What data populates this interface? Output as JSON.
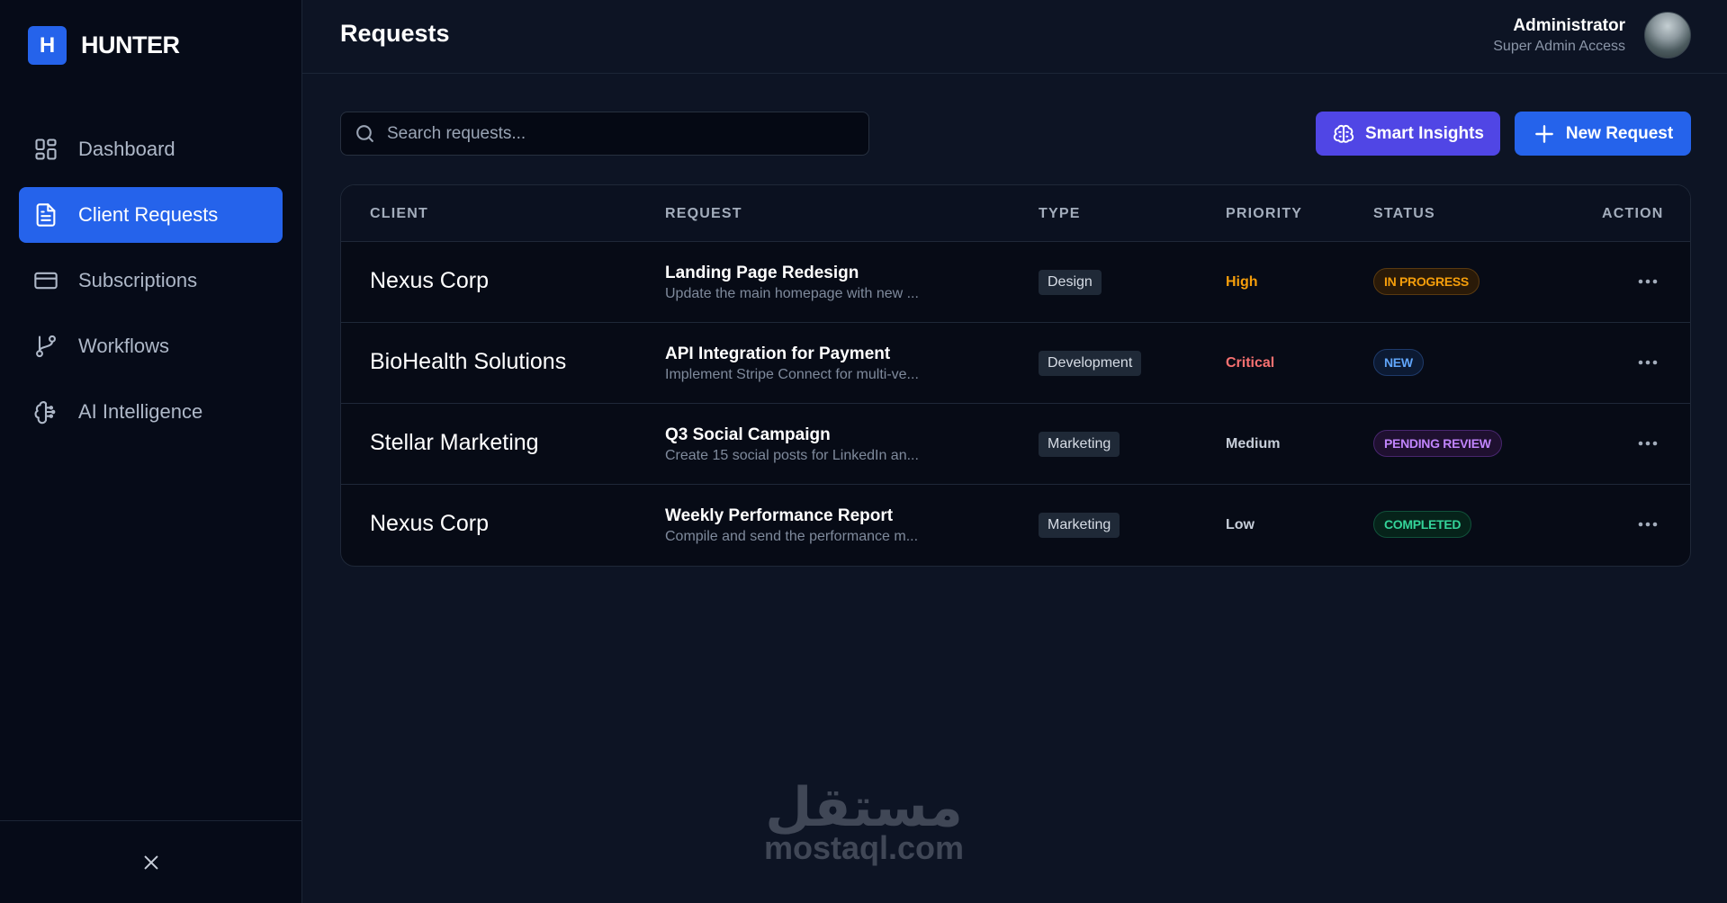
{
  "brand": {
    "badge": "H",
    "name": "HUNTER"
  },
  "sidebar": {
    "items": [
      {
        "label": "Dashboard",
        "icon": "dashboard-icon",
        "active": false
      },
      {
        "label": "Client Requests",
        "icon": "file-text-icon",
        "active": true
      },
      {
        "label": "Subscriptions",
        "icon": "credit-card-icon",
        "active": false
      },
      {
        "label": "Workflows",
        "icon": "git-branch-icon",
        "active": false
      },
      {
        "label": "AI Intelligence",
        "icon": "brain-icon",
        "active": false
      }
    ],
    "footer_icon": "close-icon"
  },
  "header": {
    "title": "Requests",
    "user": {
      "name": "Administrator",
      "role": "Super Admin Access"
    }
  },
  "toolbar": {
    "search_placeholder": "Search requests...",
    "insights_label": "Smart Insights",
    "new_label": "New Request"
  },
  "table": {
    "columns": [
      "CLIENT",
      "REQUEST",
      "TYPE",
      "PRIORITY",
      "STATUS",
      "ACTION"
    ],
    "rows": [
      {
        "client": "Nexus Corp",
        "title": "Landing Page Redesign",
        "desc": "Update the main homepage with new ...",
        "type": "Design",
        "priority": "High",
        "status": "IN PROGRESS"
      },
      {
        "client": "BioHealth Solutions",
        "title": "API Integration for Payment",
        "desc": "Implement Stripe Connect for multi-ve...",
        "type": "Development",
        "priority": "Critical",
        "status": "NEW"
      },
      {
        "client": "Stellar Marketing",
        "title": "Q3 Social Campaign",
        "desc": "Create 15 social posts for LinkedIn an...",
        "type": "Marketing",
        "priority": "Medium",
        "status": "PENDING REVIEW"
      },
      {
        "client": "Nexus Corp",
        "title": "Weekly Performance Report",
        "desc": "Compile and send the performance m...",
        "type": "Marketing",
        "priority": "Low",
        "status": "COMPLETED"
      }
    ]
  },
  "colors": {
    "accent": "#2563eb",
    "insights": "#5046e5",
    "priority_high": "#f59e0b",
    "priority_critical": "#f87171",
    "priority_medium": "#c7ced9",
    "priority_low": "#c7ced9",
    "status_in_progress": "#f59e0b",
    "status_new": "#60a5fa",
    "status_pending_review": "#c084fc",
    "status_completed": "#34d399"
  },
  "watermark": {
    "arabic": "مستقل",
    "latin": "mostaql.com"
  }
}
